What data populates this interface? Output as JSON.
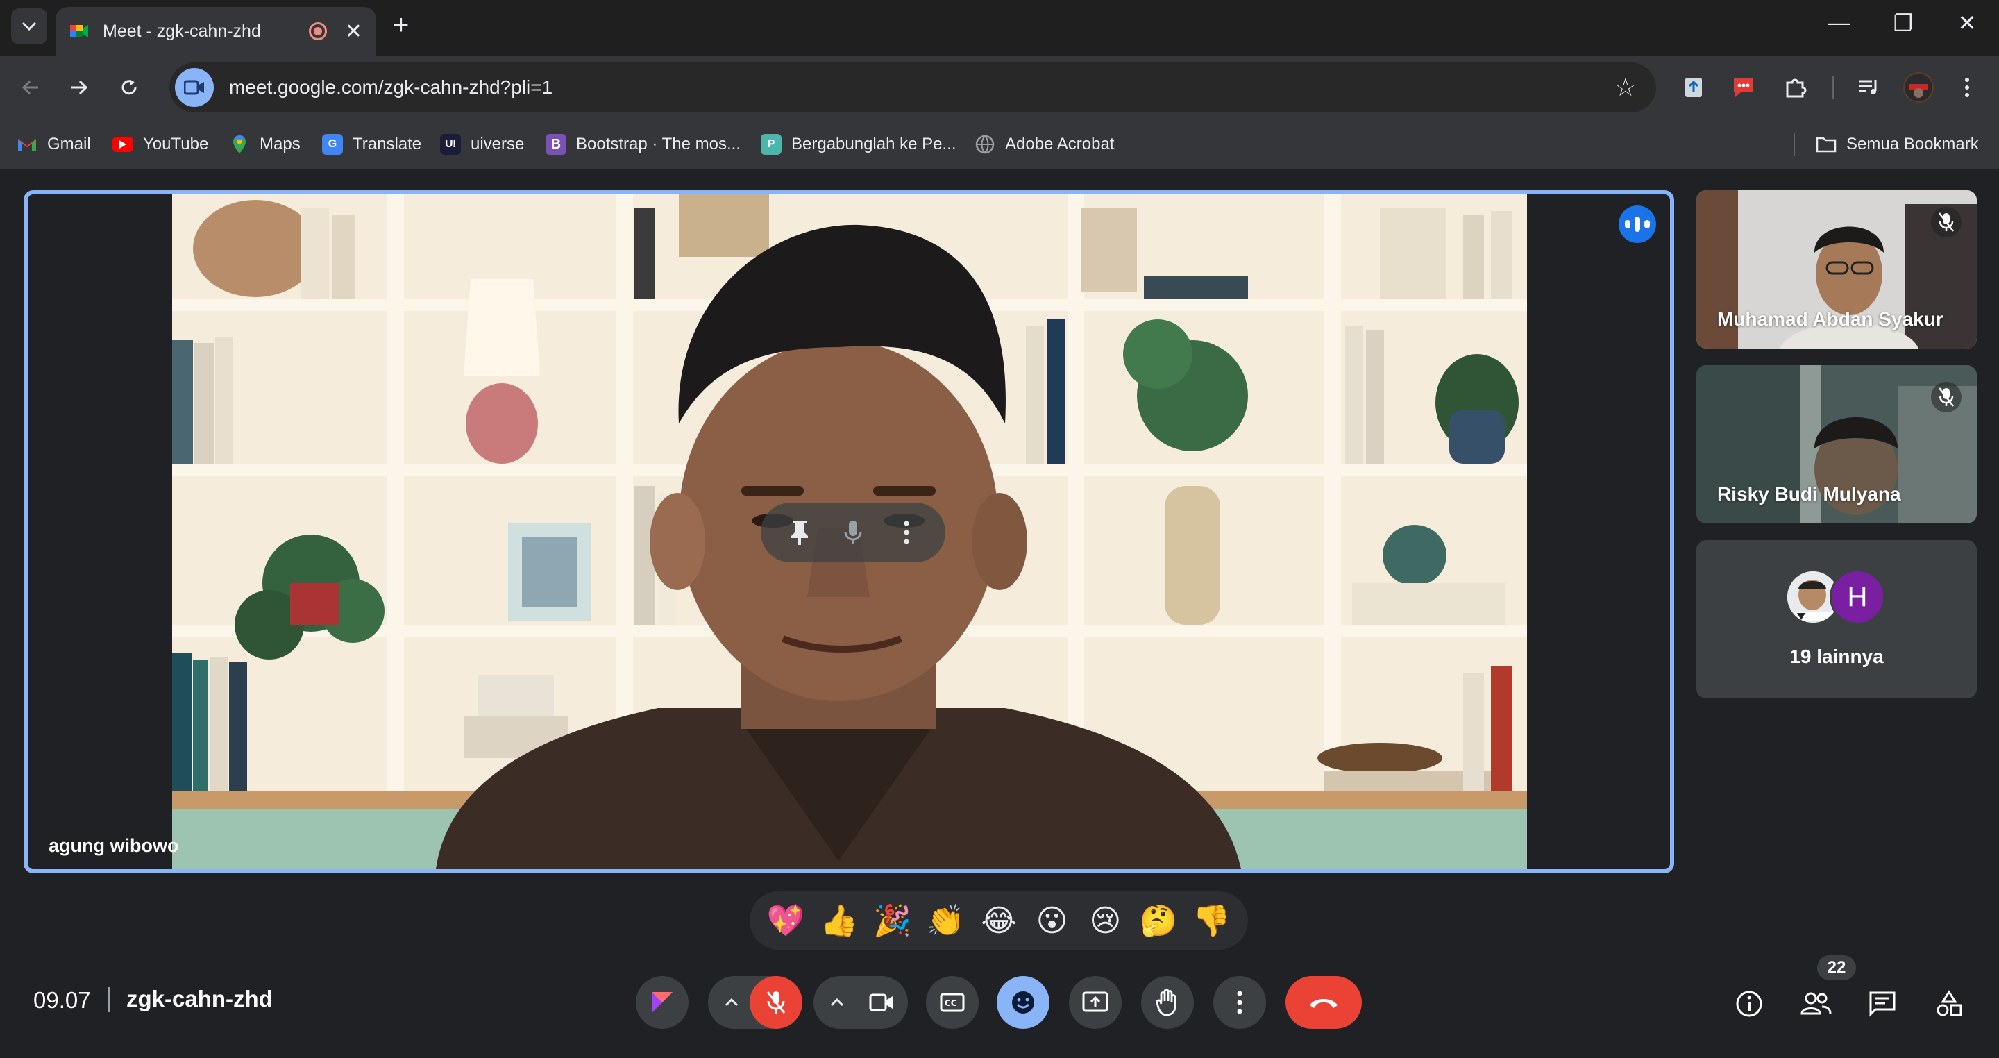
{
  "browser": {
    "tab_title": "Meet - zgk-cahn-zhd",
    "url": "meet.google.com/zgk-cahn-zhd?pli=1",
    "icons": [
      "tab-search-icon",
      "meet-favicon-icon",
      "recording-icon",
      "close-icon",
      "new-tab-icon",
      "minimize-icon",
      "restore-icon",
      "window-close-icon",
      "back-icon",
      "forward-icon",
      "reload-icon",
      "site-info-icon",
      "star-icon",
      "extension-icon",
      "chat-extension-icon",
      "puzzle-icon",
      "media-icon",
      "profile-avatar",
      "kebab-menu-icon"
    ]
  },
  "bookmarks": {
    "items": [
      {
        "label": "Gmail",
        "icon": "gmail-icon",
        "color": "#ea4335"
      },
      {
        "label": "YouTube",
        "icon": "youtube-icon",
        "color": "#ff0000"
      },
      {
        "label": "Maps",
        "icon": "maps-icon",
        "color": "#34a853"
      },
      {
        "label": "Translate",
        "icon": "translate-icon",
        "color": "#4285f4"
      },
      {
        "label": "uiverse",
        "icon": "uiverse-icon",
        "color": "#1b1b3a"
      },
      {
        "label": "Bootstrap · The mos...",
        "icon": "bootstrap-icon",
        "color": "#7952b3"
      },
      {
        "label": "Bergabunglah ke Pe...",
        "icon": "bookmark-page-icon",
        "color": "#4db6ac"
      },
      {
        "label": "Adobe Acrobat",
        "icon": "globe-icon",
        "color": "#9aa0a6"
      }
    ],
    "all_bookmarks": "Semua Bookmark"
  },
  "meet": {
    "main_speaker": "agung wibowo",
    "participants": [
      {
        "name": "Muhamad Abdan Syakur",
        "muted": true
      },
      {
        "name": "Risky Budi Mulyana",
        "muted": true
      }
    ],
    "others_avatar_letter": "H",
    "others_label": "19 lainnya",
    "reactions": [
      "💖",
      "👍",
      "🎉",
      "👏",
      "😂",
      "😮",
      "😢",
      "🤔",
      "👎"
    ],
    "time": "09.07",
    "meeting_code": "zgk-cahn-zhd",
    "people_count": "22",
    "colors": {
      "accent": "#8ab4f8",
      "hangup": "#ea4335",
      "surface": "#3c4043",
      "background": "#202124"
    }
  }
}
